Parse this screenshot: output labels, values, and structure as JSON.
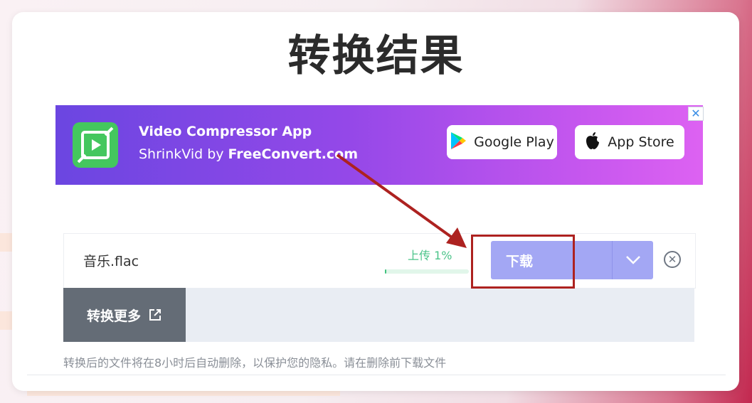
{
  "page": {
    "title": "转换结果"
  },
  "ad": {
    "app_name": "Video Compressor App",
    "subtitle_prefix": "ShrinkVid by ",
    "subtitle_brand": "FreeConvert.com",
    "google_play_label": "Google Play",
    "app_store_label": "App Store",
    "close_glyph": "✕",
    "icons": {
      "logo": "video-compress-icon",
      "google_play": "google-play-icon",
      "app_store": "apple-icon"
    }
  },
  "file": {
    "name": "音乐.flac",
    "progress_label": "上传 1%",
    "progress_fraction": 0.01,
    "download_label": "下载"
  },
  "convert_more": {
    "label": "转换更多"
  },
  "notice": "转换后的文件将在8小时后自动删除，以保护您的隐私。请在删除前下载文件",
  "colors": {
    "download_button": "#a3a7f4",
    "progress": "#41c27f",
    "annotation": "#ad2220",
    "convert_more": "#646c76"
  }
}
